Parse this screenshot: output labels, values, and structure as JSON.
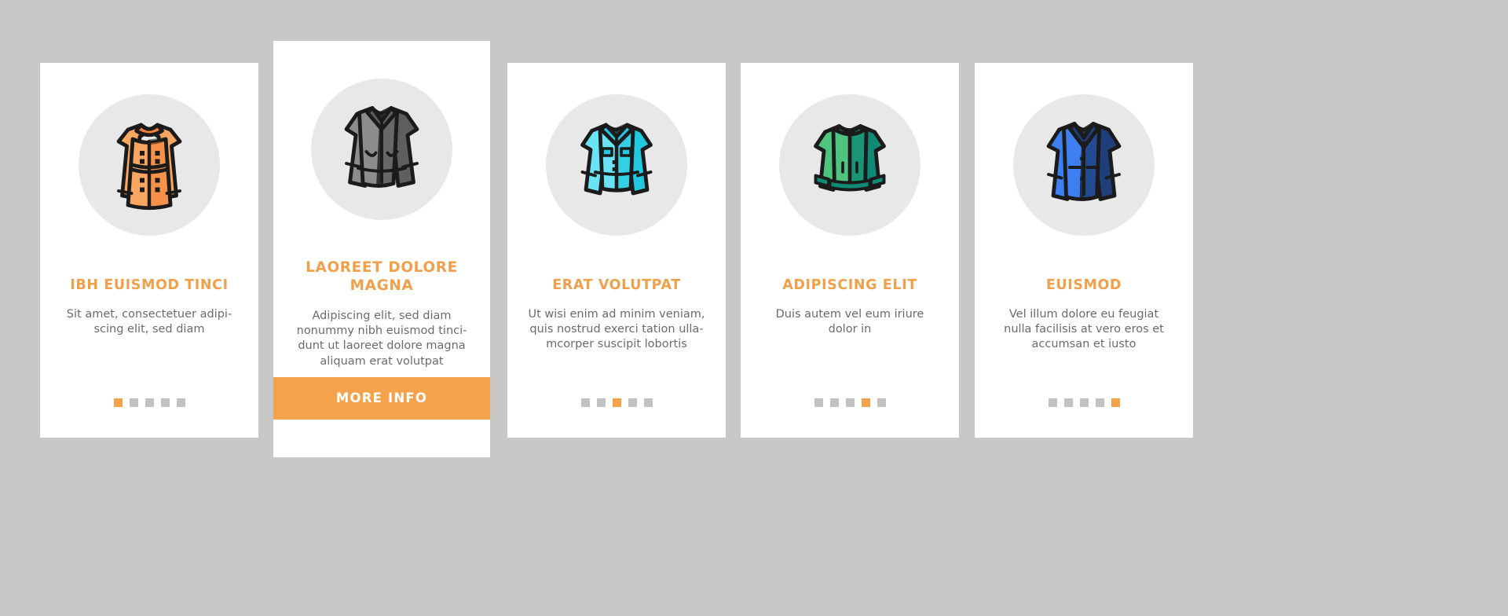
{
  "page": {
    "background_color": "#c8c8c8",
    "card_background": "#ffffff",
    "accent_color": "#f4a24c",
    "title_color": "#f0a04b",
    "body_text_color": "#6b6b6b",
    "dot_inactive_color": "#c2c2c2",
    "icon_circle_color": "#e8e8e8"
  },
  "cards": [
    {
      "icon_name": "trench-coat-icon",
      "icon_colors": {
        "fill": "#f9a661",
        "shade": "#f4803a",
        "stroke": "#1b1b1b"
      },
      "title": "IBH EUISMOD TINCI",
      "body_lines": [
        "Sit amet, consectetuer adipi-",
        "scing elit, sed diam"
      ],
      "body": "Sit amet, consectetuer adipi-scing elit, sed diam",
      "dots": {
        "count": 5,
        "active_index": 0
      },
      "featured": false
    },
    {
      "icon_name": "leather-jacket-icon",
      "icon_colors": {
        "fill": "#8d8d8d",
        "shade": "#5e5e5e",
        "stroke": "#1b1b1b"
      },
      "title": "LAOREET DOLORE MAGNA",
      "body_lines": [
        "Adipiscing elit, sed diam",
        "nonummy nibh euismod tinci-",
        "dunt ut laoreet dolore magna",
        "aliquam erat volutpat"
      ],
      "body": "Adipiscing elit, sed diam nonummy nibh euismod tincidunt ut laoreet dolore magna aliquam erat volutpat",
      "button_label": "MORE INFO",
      "featured": true
    },
    {
      "icon_name": "denim-jacket-icon",
      "icon_colors": {
        "fill": "#6ae4f5",
        "shade": "#21c8e0",
        "stroke": "#1b1b1b"
      },
      "title": "ERAT VOLUTPAT",
      "body_lines": [
        "Ut wisi enim ad minim veniam,",
        "quis nostrud exerci tation ulla-",
        "mcorper suscipit lobortis"
      ],
      "body": "Ut wisi enim ad minim veniam, quis nostrud exerci tation ullamcorper suscipit lobortis",
      "dots": {
        "count": 5,
        "active_index": 2
      },
      "featured": false
    },
    {
      "icon_name": "bomber-jacket-icon",
      "icon_colors": {
        "fill": "#4fc47f",
        "shade": "#0f8a75",
        "stroke": "#1b1b1b"
      },
      "title": "ADIPISCING ELIT",
      "body_lines": [
        "Duis autem vel eum iriure",
        "dolor in"
      ],
      "body": "Duis autem vel eum iriure dolor in",
      "dots": {
        "count": 5,
        "active_index": 3
      },
      "featured": false
    },
    {
      "icon_name": "blazer-jacket-icon",
      "icon_colors": {
        "fill": "#3d7ef0",
        "shade": "#1f3f7a",
        "stroke": "#1b1b1b"
      },
      "title": "EUISMOD",
      "body_lines": [
        "Vel illum dolore eu feugiat",
        "nulla facilisis at vero eros et",
        "accumsan et iusto"
      ],
      "body": "Vel illum dolore eu feugiat nulla facilisis at vero eros et accumsan et iusto",
      "dots": {
        "count": 5,
        "active_index": 4
      },
      "featured": false
    }
  ]
}
